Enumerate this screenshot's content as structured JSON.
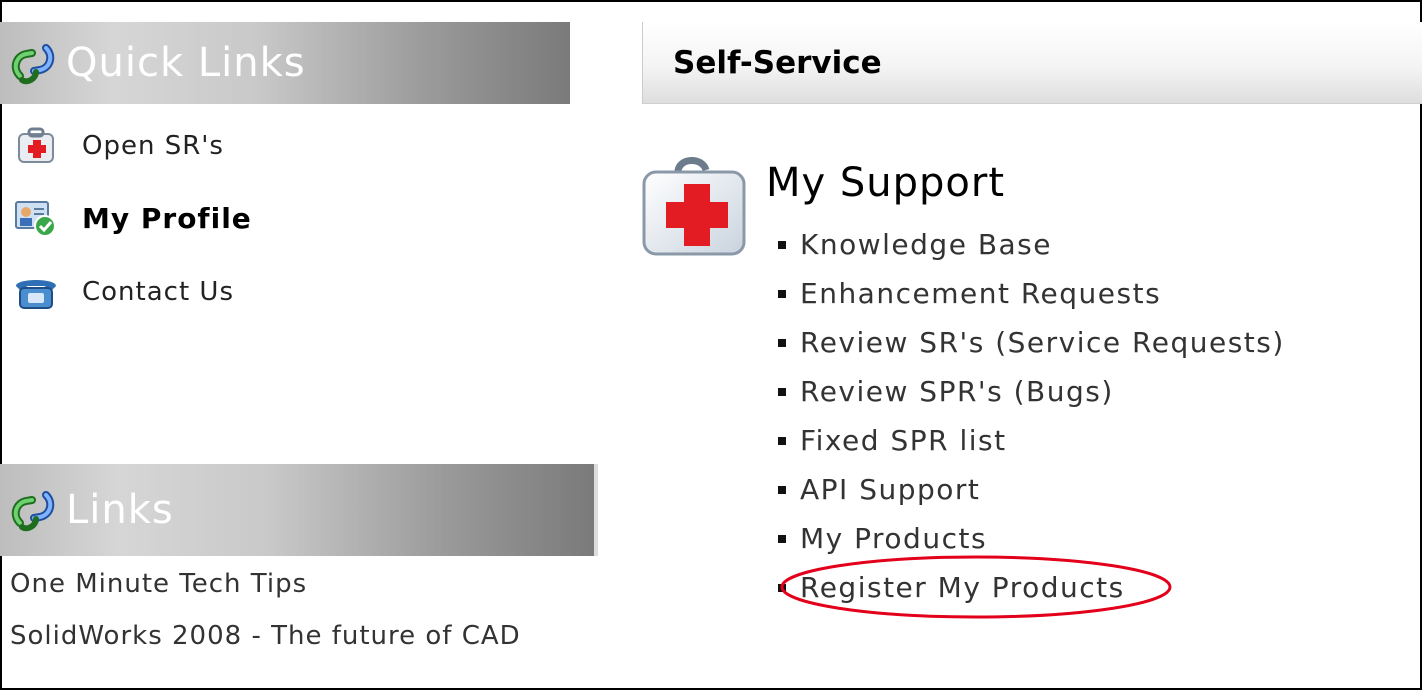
{
  "quick_links": {
    "title": "Quick Links",
    "items": [
      {
        "label": "Open SR's",
        "icon": "first-aid-kit-icon",
        "bold": false
      },
      {
        "label": "My Profile",
        "icon": "profile-card-icon",
        "bold": true
      },
      {
        "label": "Contact Us",
        "icon": "telephone-icon",
        "bold": false
      }
    ]
  },
  "links": {
    "title": "Links",
    "items": [
      {
        "label": "One Minute Tech Tips"
      },
      {
        "label": "SolidWorks 2008 - The future of CAD"
      }
    ]
  },
  "self_service": {
    "title": "Self-Service",
    "section_title": "My Support",
    "items": [
      {
        "label": "Knowledge Base"
      },
      {
        "label": "Enhancement Requests"
      },
      {
        "label": "Review SR's (Service Requests)"
      },
      {
        "label": "Review SPR's (Bugs)"
      },
      {
        "label": "Fixed SPR list"
      },
      {
        "label": "API Support"
      },
      {
        "label": "My Products"
      },
      {
        "label": "Register My Products"
      }
    ],
    "highlighted_item": "Register My Products"
  },
  "colors": {
    "highlight": "#e3001b",
    "header_gradient_dark": "#7a7a7a",
    "header_gradient_light": "#d6d6d6"
  }
}
